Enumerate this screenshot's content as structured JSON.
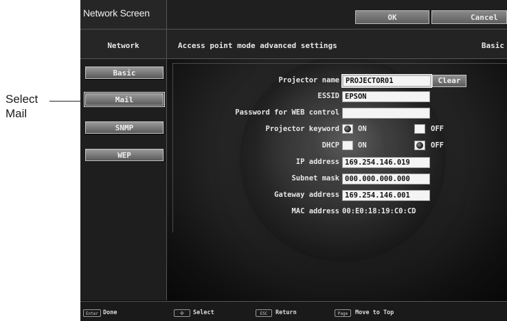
{
  "callout": {
    "line1": "Select",
    "line2": "Mail"
  },
  "title": "Network Screen",
  "top_buttons": {
    "ok": "OK",
    "cancel": "Cancel"
  },
  "sidebar": {
    "heading": "Network",
    "tabs": [
      {
        "label": "Basic"
      },
      {
        "label": "Mail",
        "selected": true
      },
      {
        "label": "SNMP"
      },
      {
        "label": "WEP"
      }
    ]
  },
  "content": {
    "heading": "Access point mode advanced settings",
    "breadcrumb_tab": "Basic",
    "fields": {
      "projector_name": {
        "label": "Projector name",
        "value": "PROJECTOR01",
        "clear_label": "Clear"
      },
      "essid": {
        "label": "ESSID",
        "value": "EPSON"
      },
      "web_password": {
        "label": "Password for WEB control",
        "value": ""
      },
      "projector_keyword": {
        "label": "Projector keyword",
        "on": "ON",
        "off": "OFF",
        "selected": "ON"
      },
      "dhcp": {
        "label": "DHCP",
        "on": "ON",
        "off": "OFF",
        "selected": "OFF"
      },
      "ip_address": {
        "label": "IP address",
        "value": "169.254.146.019"
      },
      "subnet_mask": {
        "label": "Subnet mask",
        "value": "000.000.000.000"
      },
      "gateway_address": {
        "label": "Gateway address",
        "value": "169.254.146.001"
      },
      "mac_address": {
        "label": "MAC address",
        "value": "00:E0:18:19:C0:CD"
      }
    }
  },
  "footer": [
    {
      "key": "Enter",
      "label": "Done"
    },
    {
      "key": "✣",
      "label": "Select"
    },
    {
      "key": "ESC",
      "label": "Return"
    },
    {
      "key": "Page",
      "label": "Move to Top"
    }
  ]
}
